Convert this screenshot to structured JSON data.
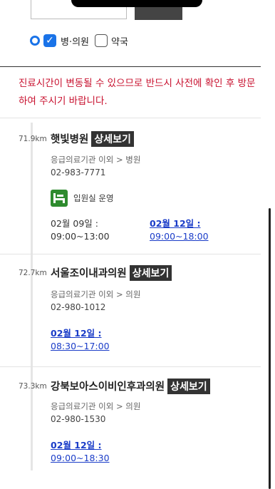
{
  "filters": {
    "hospital_clinic_label": "병·의원",
    "pharmacy_label": "약국"
  },
  "notice": "진료시간이 변동될 수 있으므로 반드시 사전에 확인 후 방문하여 주시기 바랍니다.",
  "detail_label": "상세보기",
  "items": [
    {
      "distance": "71.9km",
      "name": "햇빛병원",
      "category": "응급의료기관 이외 > 병원",
      "phone": "02-983-7771",
      "feature": "입원실 운영",
      "hours": [
        {
          "date": "02월 09일 :",
          "time": "09:00~13:00"
        },
        {
          "date": "02월 12일 :",
          "time": "09:00~18:00"
        }
      ]
    },
    {
      "distance": "72.7km",
      "name": "서울조이내과의원",
      "category": "응급의료기관 이외 > 의원",
      "phone": "02-980-1012",
      "hours": [
        {
          "date": "02월 12일 :",
          "time": "08:30~17:00"
        }
      ]
    },
    {
      "distance": "73.3km",
      "name": "강북보아스이비인후과의원",
      "category": "응급의료기관 이외 > 의원",
      "phone": "02-980-1530",
      "hours": [
        {
          "date": "02월 12일 :",
          "time": "09:00~18:30"
        }
      ]
    }
  ],
  "colors": {
    "accent": "#1a73e8",
    "notice": "#c8102e",
    "link": "#1a3cc8",
    "feature_icon": "#2e8b2e"
  }
}
